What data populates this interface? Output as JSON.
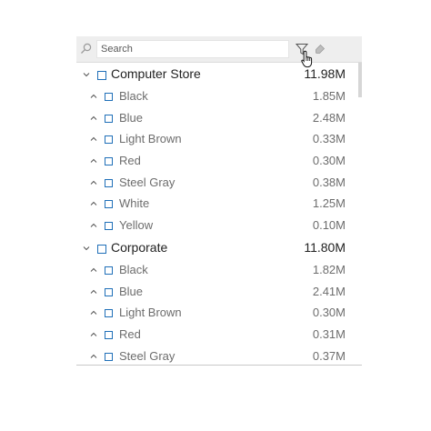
{
  "search": {
    "placeholder": "Search"
  },
  "groups": [
    {
      "label": "Computer Store",
      "value": "11.98M",
      "items": [
        {
          "label": "Black",
          "value": "1.85M"
        },
        {
          "label": "Blue",
          "value": "2.48M"
        },
        {
          "label": "Light Brown",
          "value": "0.33M"
        },
        {
          "label": "Red",
          "value": "0.30M"
        },
        {
          "label": "Steel Gray",
          "value": "0.38M"
        },
        {
          "label": "White",
          "value": "1.25M"
        },
        {
          "label": "Yellow",
          "value": "0.10M"
        }
      ]
    },
    {
      "label": "Corporate",
      "value": "11.80M",
      "items": [
        {
          "label": "Black",
          "value": "1.82M"
        },
        {
          "label": "Blue",
          "value": "2.41M"
        },
        {
          "label": "Light Brown",
          "value": "0.30M"
        },
        {
          "label": "Red",
          "value": "0.31M"
        },
        {
          "label": "Steel Gray",
          "value": "0.37M"
        }
      ]
    }
  ],
  "colors": {
    "accent": "#1f6fb8",
    "toolbar_bg": "#eeeeee",
    "muted_text": "#6d6d6d",
    "primary_text": "#222222"
  },
  "icons": {
    "search": "search-icon",
    "filter": "filter-icon",
    "eraser": "eraser-icon",
    "expand": "chevron-down-icon",
    "collapse": "chevron-up-icon"
  }
}
